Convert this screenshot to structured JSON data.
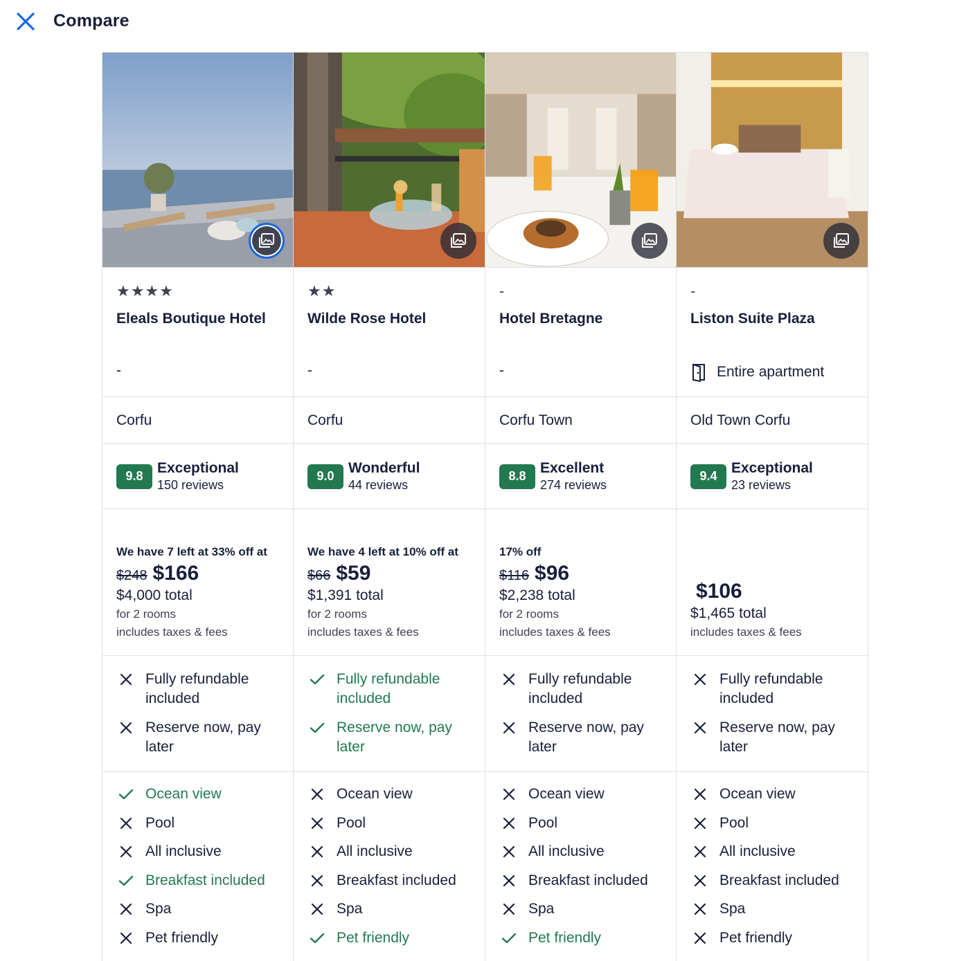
{
  "header": {
    "title": "Compare",
    "close_icon": "close-icon"
  },
  "colors": {
    "accent": "#1668e3",
    "positive": "#227950",
    "text": "#191e3b"
  },
  "hotels": [
    {
      "stars": "★★★★",
      "name": "Eleals Boutique Hotel",
      "property_type": "-",
      "location": "Corfu",
      "score": "9.8",
      "rating_label": "Exceptional",
      "reviews": "150 reviews",
      "promo": "We have 7 left at 33% off at",
      "strike_price": "$248",
      "price": "$166",
      "total": "$4,000 total",
      "rooms": "for 2 rooms",
      "taxes": "includes taxes & fees",
      "policies": [
        {
          "label": "Fully refundable included",
          "included": false
        },
        {
          "label": "Reserve now, pay later",
          "included": false
        }
      ],
      "amenities": [
        {
          "label": "Ocean view",
          "included": true
        },
        {
          "label": "Pool",
          "included": false
        },
        {
          "label": "All inclusive",
          "included": false
        },
        {
          "label": "Breakfast included",
          "included": true
        },
        {
          "label": "Spa",
          "included": false
        },
        {
          "label": "Pet friendly",
          "included": false
        }
      ]
    },
    {
      "stars": "★★",
      "name": "Wilde Rose Hotel",
      "property_type": "-",
      "location": "Corfu",
      "score": "9.0",
      "rating_label": "Wonderful",
      "reviews": "44 reviews",
      "promo": "We have 4 left at 10% off at",
      "strike_price": "$66",
      "price": "$59",
      "total": "$1,391 total",
      "rooms": "for 2 rooms",
      "taxes": "includes taxes & fees",
      "policies": [
        {
          "label": "Fully refundable included",
          "included": true
        },
        {
          "label": "Reserve now, pay later",
          "included": true
        }
      ],
      "amenities": [
        {
          "label": "Ocean view",
          "included": false
        },
        {
          "label": "Pool",
          "included": false
        },
        {
          "label": "All inclusive",
          "included": false
        },
        {
          "label": "Breakfast included",
          "included": false
        },
        {
          "label": "Spa",
          "included": false
        },
        {
          "label": "Pet friendly",
          "included": true
        }
      ]
    },
    {
      "stars": "-",
      "name": "Hotel Bretagne",
      "property_type": "-",
      "location": "Corfu Town",
      "score": "8.8",
      "rating_label": "Excellent",
      "reviews": "274 reviews",
      "promo": "17% off",
      "strike_price": "$116",
      "price": "$96",
      "total": "$2,238 total",
      "rooms": "for 2 rooms",
      "taxes": "includes taxes & fees",
      "policies": [
        {
          "label": "Fully refundable included",
          "included": false
        },
        {
          "label": "Reserve now, pay later",
          "included": false
        }
      ],
      "amenities": [
        {
          "label": "Ocean view",
          "included": false
        },
        {
          "label": "Pool",
          "included": false
        },
        {
          "label": "All inclusive",
          "included": false
        },
        {
          "label": "Breakfast included",
          "included": false
        },
        {
          "label": "Spa",
          "included": false
        },
        {
          "label": "Pet friendly",
          "included": true
        }
      ]
    },
    {
      "stars": "-",
      "name": "Liston Suite Plaza",
      "property_type": "Entire apartment",
      "property_icon": "door-icon",
      "location": "Old Town Corfu",
      "score": "9.4",
      "rating_label": "Exceptional",
      "reviews": "23 reviews",
      "promo": "",
      "strike_price": "",
      "price": "$106",
      "total": "$1,465 total",
      "rooms": "",
      "taxes": "includes taxes & fees",
      "policies": [
        {
          "label": "Fully refundable included",
          "included": false
        },
        {
          "label": "Reserve now, pay later",
          "included": false
        }
      ],
      "amenities": [
        {
          "label": "Ocean view",
          "included": false
        },
        {
          "label": "Pool",
          "included": false
        },
        {
          "label": "All inclusive",
          "included": false
        },
        {
          "label": "Breakfast included",
          "included": false
        },
        {
          "label": "Spa",
          "included": false
        },
        {
          "label": "Pet friendly",
          "included": false
        }
      ]
    }
  ]
}
